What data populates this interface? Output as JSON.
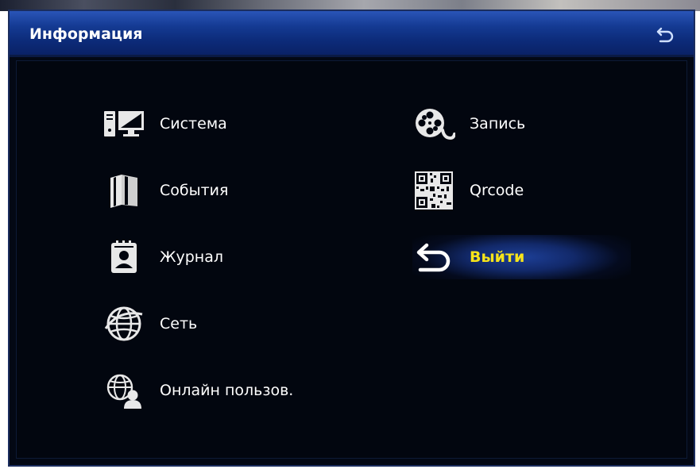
{
  "header": {
    "title": "Информация"
  },
  "menu": {
    "left": [
      {
        "label": "Система",
        "icon": "computer-monitor-icon"
      },
      {
        "label": "События",
        "icon": "book-icon"
      },
      {
        "label": "Журнал",
        "icon": "contact-card-icon"
      },
      {
        "label": "Сеть",
        "icon": "globe-icon"
      },
      {
        "label": "Онлайн пользов.",
        "icon": "globe-user-icon"
      }
    ],
    "right": [
      {
        "label": "Запись",
        "icon": "film-reel-icon"
      },
      {
        "label": "Qrcode",
        "icon": "qr-code-icon"
      },
      {
        "label": "Выйти",
        "icon": "return-arrow-icon",
        "selected": true
      }
    ]
  },
  "colors": {
    "selected_text": "#f7e41a",
    "title_bar": "#143a92",
    "background": "#02060f"
  }
}
